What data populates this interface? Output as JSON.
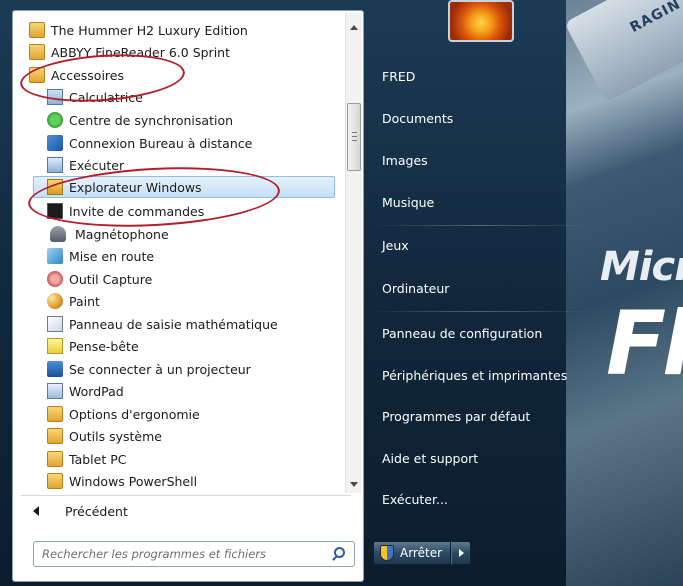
{
  "programs": {
    "items": [
      {
        "label": "The Hummer H2 Luxury Edition",
        "icon": "folder-icon"
      },
      {
        "label": "ABBYY FineReader 6.0 Sprint",
        "icon": "folder-icon"
      },
      {
        "label": "Accessoires",
        "icon": "folder-icon"
      },
      {
        "label": "Calculatrice",
        "icon": "calculator-icon"
      },
      {
        "label": "Centre de synchronisation",
        "icon": "sync-center-icon"
      },
      {
        "label": "Connexion Bureau à distance",
        "icon": "remote-desktop-icon"
      },
      {
        "label": "Exécuter",
        "icon": "run-icon"
      },
      {
        "label": "Explorateur Windows",
        "icon": "windows-explorer-icon"
      },
      {
        "label": "Invite de commandes",
        "icon": "command-prompt-icon"
      },
      {
        "label": "Magnétophone",
        "icon": "microphone-icon"
      },
      {
        "label": "Mise en route",
        "icon": "getting-started-icon"
      },
      {
        "label": "Outil Capture",
        "icon": "snipping-tool-icon"
      },
      {
        "label": "Paint",
        "icon": "paint-icon"
      },
      {
        "label": "Panneau de saisie mathématique",
        "icon": "math-input-icon"
      },
      {
        "label": "Pense-bête",
        "icon": "sticky-notes-icon"
      },
      {
        "label": "Se connecter à un projecteur",
        "icon": "projector-icon"
      },
      {
        "label": "WordPad",
        "icon": "wordpad-icon"
      },
      {
        "label": "Options d'ergonomie",
        "icon": "folder-icon"
      },
      {
        "label": "Outils système",
        "icon": "folder-icon"
      },
      {
        "label": "Tablet PC",
        "icon": "folder-icon"
      },
      {
        "label": "Windows PowerShell",
        "icon": "folder-icon"
      }
    ],
    "back_label": "Précédent"
  },
  "search": {
    "placeholder": "Rechercher les programmes et fichiers"
  },
  "right_pane": {
    "items": [
      "FRED",
      "Documents",
      "Images",
      "Musique",
      "Jeux",
      "Ordinateur",
      "Panneau de configuration",
      "Périphériques et imprimantes",
      "Programmes par défaut",
      "Aide et support",
      "Exécuter..."
    ]
  },
  "shutdown": {
    "label": "Arrêter"
  },
  "wallpaper": {
    "wing_text": "RAGIN",
    "brand_line1": "Micr",
    "brand_line2": "Flig"
  },
  "colors": {
    "annotation": "#b01f2a",
    "selection": "#c7e0f6",
    "right_pane_bg": "#1c3b55"
  }
}
